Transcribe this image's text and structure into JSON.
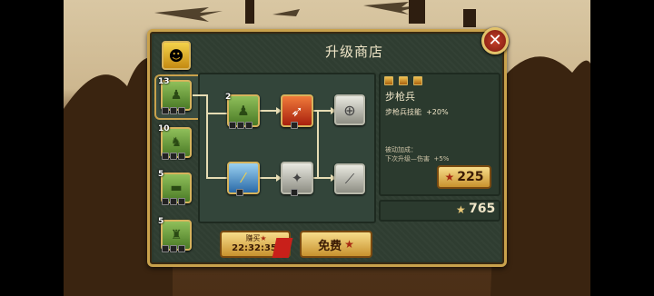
{
  "shop": {
    "title": "升级商店",
    "close_icon": "close-icon"
  },
  "units": [
    {
      "level": "13",
      "selected": true
    },
    {
      "level": "10",
      "selected": false
    },
    {
      "level": "5",
      "selected": false
    },
    {
      "level": "5",
      "selected": false
    }
  ],
  "tree": {
    "root_level": "2"
  },
  "info": {
    "unit_name": "步枪兵",
    "skill_label": "步枪兵技能",
    "skill_value": "+20%",
    "bonus_title": "被动加成：",
    "bonus_line_label": "下次升级—伤害",
    "bonus_line_value": "+5%",
    "price": "225"
  },
  "coins": {
    "amount": "765"
  },
  "buttons": {
    "timer_label": "赚买",
    "timer_value": "22:32:35",
    "free_label": "免费"
  },
  "colors": {
    "gold_border": "#c9a24c",
    "panel_bg": "#2f3d31",
    "button_gold": "#f7dc8a",
    "close_red": "#c8402a"
  }
}
